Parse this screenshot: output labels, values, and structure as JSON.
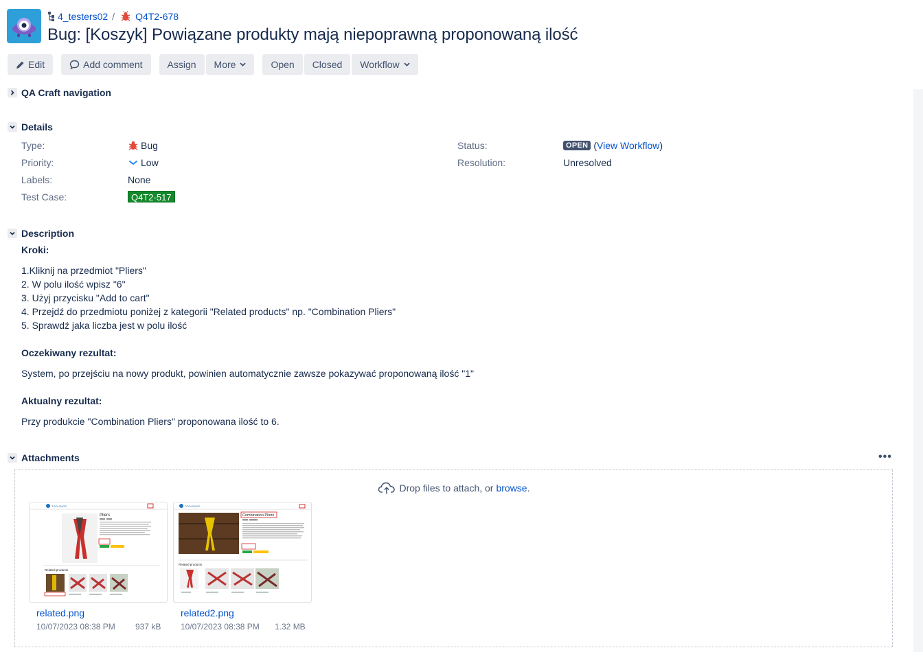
{
  "breadcrumbs": {
    "project": "4_testers02",
    "separator": "/",
    "issue_key": "Q4T2-678"
  },
  "issue": {
    "title": "Bug:  [Koszyk] Powiązane produkty mają niepoprawną proponowaną ilość"
  },
  "toolbar": {
    "edit": "Edit",
    "add_comment": "Add comment",
    "assign": "Assign",
    "more": "More",
    "open": "Open",
    "closed": "Closed",
    "workflow": "Workflow"
  },
  "sections": {
    "navigation": "QA Craft navigation",
    "details": "Details",
    "description": "Description",
    "attachments": "Attachments"
  },
  "details": {
    "type_label": "Type:",
    "type_value": "Bug",
    "priority_label": "Priority:",
    "priority_value": "Low",
    "labels_label": "Labels:",
    "labels_value": "None",
    "testcase_label": "Test Case:",
    "testcase_value": "Q4T2-517",
    "status_label": "Status:",
    "status_value": "OPEN",
    "view_workflow": "View Workflow",
    "resolution_label": "Resolution:",
    "resolution_value": "Unresolved"
  },
  "description": {
    "steps_heading": "Kroki:",
    "steps": [
      "1.Kliknij na przedmiot \"Pliers\"",
      "2. W polu ilość wpisz \"6\"",
      "3. Użyj przycisku \"Add to cart\"",
      "4. Przejdź do przedmiotu poniżej z kategorii \"Related products\" np. \"Combination Pliers\"",
      "5. Sprawdź jaka liczba jest w polu ilość"
    ],
    "expected_heading": "Oczekiwany rezultat:",
    "expected_text": "System, po przejściu na nowy produkt, powinien automatycznie zawsze pokazywać proponowaną ilość \"1\"",
    "actual_heading": "Aktualny rezultat:",
    "actual_text": "Przy produkcie \"Combination Pliers\" proponowana ilość to 6."
  },
  "attachments": {
    "drop_text": "Drop files to attach, or",
    "browse": "browse",
    "browse_suffix": ".",
    "more": "•••",
    "items": [
      {
        "name": "related.png",
        "date": "10/07/2023 08:38 PM",
        "size": "937 kB",
        "thumb_title": "Pliers",
        "thumb_related": "Related products",
        "logo": "TOOLSHOP"
      },
      {
        "name": "related2.png",
        "date": "10/07/2023 08:38 PM",
        "size": "1.32 MB",
        "thumb_title": "Combination Pliers",
        "thumb_related": "Related products",
        "logo": "TOOLSHOP"
      }
    ]
  },
  "colors": {
    "link": "#0052cc",
    "status_open": "#42526e",
    "test_case": "#14892c",
    "bug": "#e5493a",
    "priority_low": "#2684ff"
  }
}
